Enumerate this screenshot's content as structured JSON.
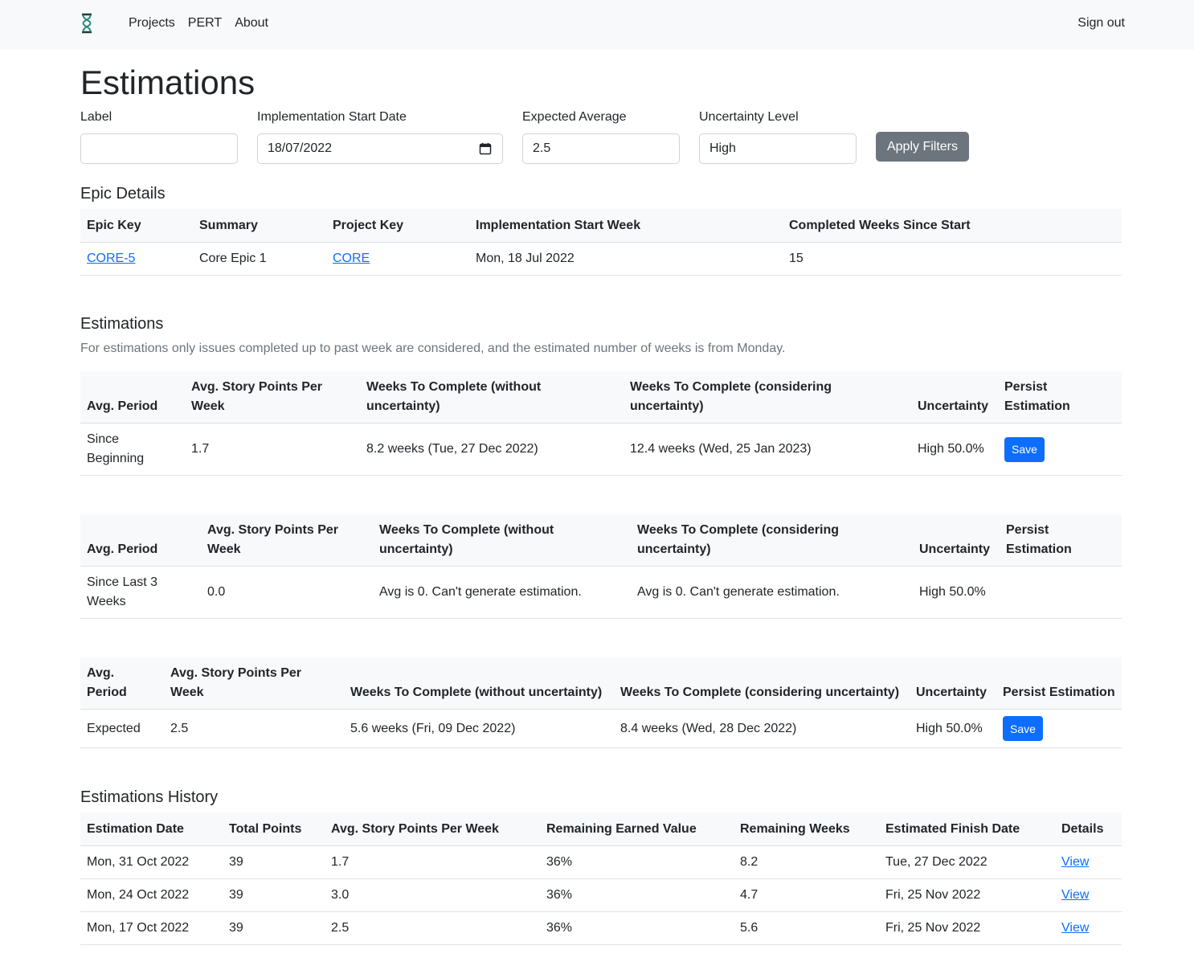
{
  "nav": {
    "links": [
      "Projects",
      "PERT",
      "About"
    ],
    "signout": "Sign out"
  },
  "page_title": "Estimations",
  "filters": {
    "label": {
      "label": "Label",
      "value": ""
    },
    "start_date": {
      "label": "Implementation Start Date",
      "value": "18/07/2022"
    },
    "expected_average": {
      "label": "Expected Average",
      "value": "2.5"
    },
    "uncertainty": {
      "label": "Uncertainty Level",
      "value": "High"
    },
    "apply": "Apply Filters"
  },
  "epic": {
    "title": "Epic Details",
    "headers": [
      "Epic Key",
      "Summary",
      "Project Key",
      "Implementation Start Week",
      "Completed Weeks Since Start"
    ],
    "row": {
      "epic_key": "CORE-5",
      "summary": "Core Epic 1",
      "project_key": "CORE",
      "start_week": "Mon, 18 Jul 2022",
      "completed_weeks": "15"
    }
  },
  "estimations": {
    "title": "Estimations",
    "note": "For estimations only issues completed up to past week are considered, and the estimated number of weeks is from Monday.",
    "headers": [
      "Avg. Period",
      "Avg. Story Points Per Week",
      "Weeks To Complete (without uncertainty)",
      "Weeks To Complete (considering uncertainty)",
      "Uncertainty",
      "Persist Estimation"
    ],
    "save": "Save",
    "tables": [
      {
        "period": "Since Beginning",
        "avg": "1.7",
        "without": "8.2 weeks (Tue, 27 Dec 2022)",
        "considering": "12.4 weeks (Wed, 25 Jan 2023)",
        "uncertainty": "High 50.0%",
        "has_save": true
      },
      {
        "period": "Since Last 3 Weeks",
        "avg": "0.0",
        "without": "Avg is 0. Can't generate estimation.",
        "considering": "Avg is 0. Can't generate estimation.",
        "uncertainty": "High 50.0%",
        "has_save": false
      },
      {
        "period": "Expected",
        "avg": "2.5",
        "without": "5.6 weeks (Fri, 09 Dec 2022)",
        "considering": "8.4 weeks (Wed, 28 Dec 2022)",
        "uncertainty": "High 50.0%",
        "has_save": true
      }
    ]
  },
  "history": {
    "title": "Estimations History",
    "headers": [
      "Estimation Date",
      "Total Points",
      "Avg. Story Points Per Week",
      "Remaining Earned Value",
      "Remaining Weeks",
      "Estimated Finish Date",
      "Details"
    ],
    "rows": [
      {
        "date": "Mon, 31 Oct 2022",
        "total": "39",
        "avg": "1.7",
        "rev": "36%",
        "weeks": "8.2",
        "finish": "Tue, 27 Dec 2022",
        "details": "View"
      },
      {
        "date": "Mon, 24 Oct 2022",
        "total": "39",
        "avg": "3.0",
        "rev": "36%",
        "weeks": "4.7",
        "finish": "Fri, 25 Nov 2022",
        "details": "View"
      },
      {
        "date": "Mon, 17 Oct 2022",
        "total": "39",
        "avg": "2.5",
        "rev": "36%",
        "weeks": "5.6",
        "finish": "Fri, 25 Nov 2022",
        "details": "View"
      }
    ]
  }
}
